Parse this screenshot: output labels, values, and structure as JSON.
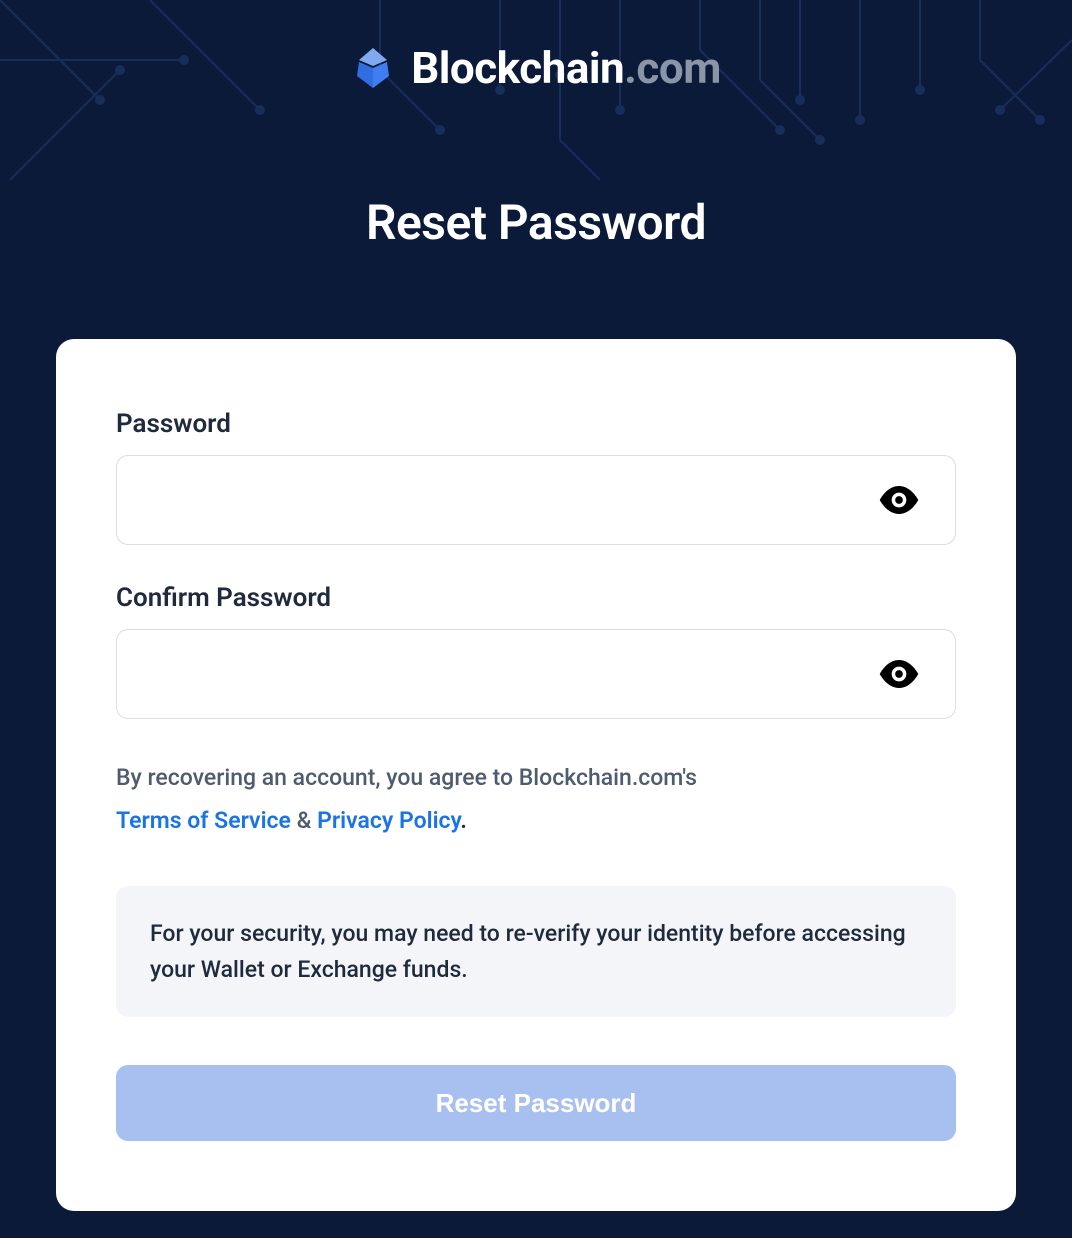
{
  "brand": {
    "name_primary": "Blockchain",
    "name_suffix": ".com"
  },
  "page": {
    "title": "Reset Password"
  },
  "form": {
    "password_label": "Password",
    "password_value": "",
    "confirm_label": "Confirm Password",
    "confirm_value": "",
    "submit_label": "Reset Password"
  },
  "legal": {
    "prefix": "By recovering an account, you agree to Blockchain.com's",
    "tos_label": "Terms of Service",
    "amp": " & ",
    "privacy_label": "Privacy Policy",
    "suffix_dot": "."
  },
  "notice": {
    "text": "For your security, you may need to re-verify your identity before accessing your Wallet or Exchange funds."
  }
}
